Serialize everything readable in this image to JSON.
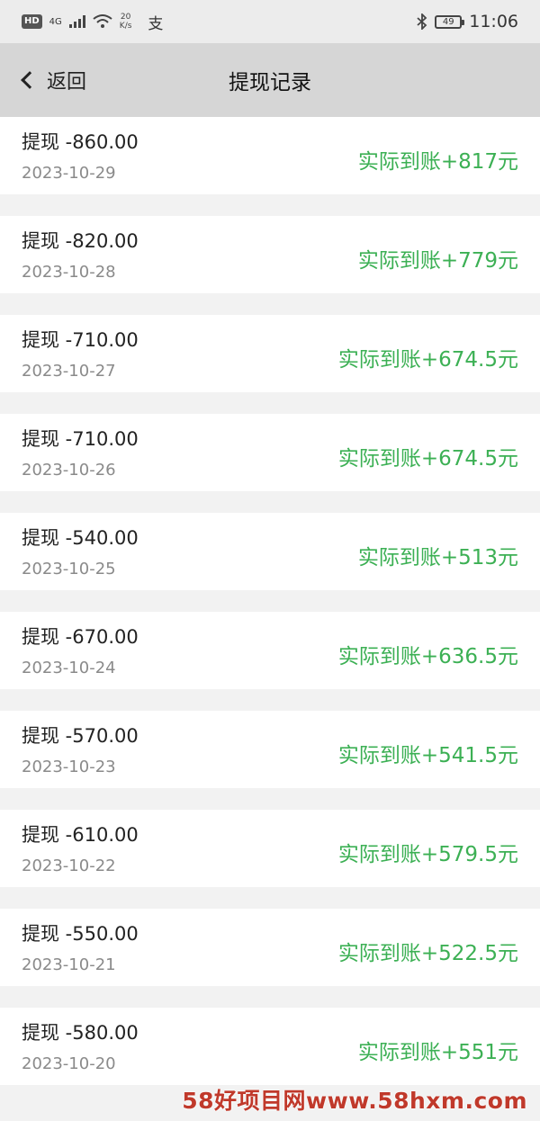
{
  "status_bar": {
    "hd": "HD",
    "network": "4G",
    "speed_value": "20",
    "speed_unit": "K/s",
    "alipay_glyph": "支",
    "battery": "49",
    "time": "11:06"
  },
  "nav": {
    "back_label": "返回",
    "title": "提现记录"
  },
  "records": [
    {
      "title": "提现 -860.00",
      "date": "2023-10-29",
      "amount": "实际到账+817元"
    },
    {
      "title": "提现 -820.00",
      "date": "2023-10-28",
      "amount": "实际到账+779元"
    },
    {
      "title": "提现 -710.00",
      "date": "2023-10-27",
      "amount": "实际到账+674.5元"
    },
    {
      "title": "提现 -710.00",
      "date": "2023-10-26",
      "amount": "实际到账+674.5元"
    },
    {
      "title": "提现 -540.00",
      "date": "2023-10-25",
      "amount": "实际到账+513元"
    },
    {
      "title": "提现 -670.00",
      "date": "2023-10-24",
      "amount": "实际到账+636.5元"
    },
    {
      "title": "提现 -570.00",
      "date": "2023-10-23",
      "amount": "实际到账+541.5元"
    },
    {
      "title": "提现 -610.00",
      "date": "2023-10-22",
      "amount": "实际到账+579.5元"
    },
    {
      "title": "提现 -550.00",
      "date": "2023-10-21",
      "amount": "实际到账+522.5元"
    },
    {
      "title": "提现 -580.00",
      "date": "2023-10-20",
      "amount": "实际到账+551元"
    }
  ],
  "watermark": "58好项目网www.58hxm.com",
  "colors": {
    "amount_green": "#3cb054",
    "nav_bg": "#d6d6d6",
    "page_bg": "#f2f2f2",
    "watermark_red": "#c0392b"
  }
}
